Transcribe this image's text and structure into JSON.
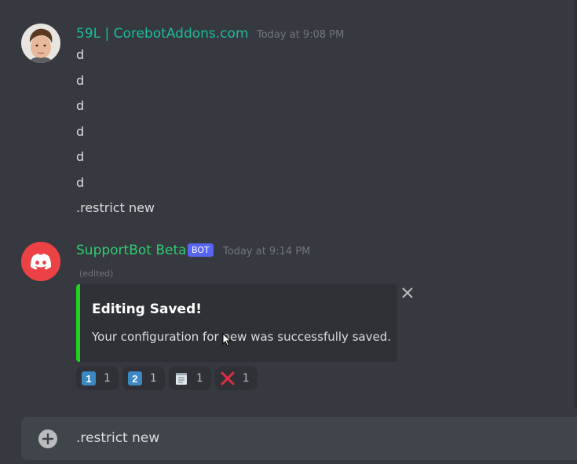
{
  "messages": [
    {
      "username": "59L | CorebotAddons.com",
      "username_color": "#1abc9c",
      "timestamp": "Today at 9:08 PM",
      "lines": [
        "d",
        "d",
        "d",
        "d",
        "d",
        "d",
        ".restrict new"
      ]
    },
    {
      "username": "SupportBot Beta",
      "username_color": "#2ecc71",
      "bot_tag": "BOT",
      "timestamp": "Today at 9:14 PM",
      "edited": "(edited)",
      "embed": {
        "title": "Editing Saved!",
        "description": "Your configuration for new was successfully saved.",
        "color": "#1fd31f"
      },
      "reactions": [
        {
          "emoji": "keycap-1",
          "count": "1"
        },
        {
          "emoji": "keycap-2",
          "count": "1"
        },
        {
          "emoji": "notepad",
          "count": "1"
        },
        {
          "emoji": "cross-mark",
          "count": "1"
        }
      ]
    }
  ],
  "composer": {
    "text": ".restrict new"
  },
  "colors": {
    "background": "#36393f",
    "embed_bg": "#2f3136",
    "blurple": "#5865f2",
    "discord_red": "#ed4245"
  }
}
